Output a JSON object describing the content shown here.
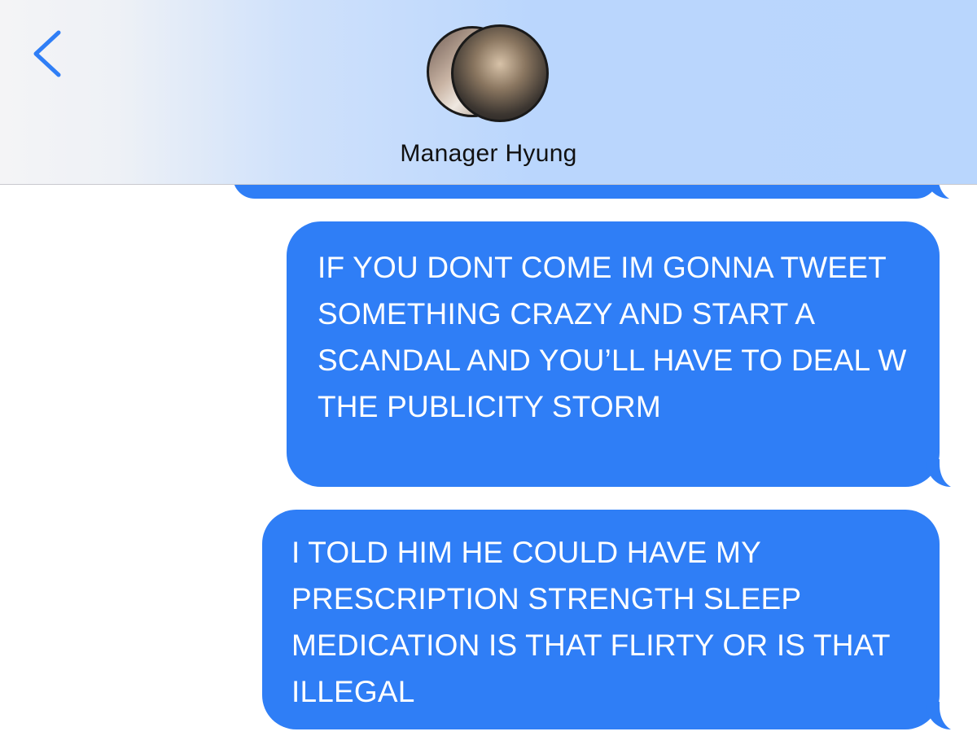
{
  "header": {
    "contact_name": "Manager Hyung",
    "back_icon": "chevron-left-icon",
    "accent_color": "#2f7ef6"
  },
  "messages": [
    {
      "direction": "outgoing",
      "text": "IF YOU DONT COME IM GONNA TWEET SOMETHING CRAZY AND START A SCANDAL AND YOU’LL HAVE TO DEAL W THE PUBLICITY STORM"
    },
    {
      "direction": "outgoing",
      "text": "I TOLD HIM HE COULD HAVE MY PRESCRIPTION STRENGTH SLEEP MEDICATION IS THAT FLIRTY OR IS THAT ILLEGAL"
    }
  ]
}
